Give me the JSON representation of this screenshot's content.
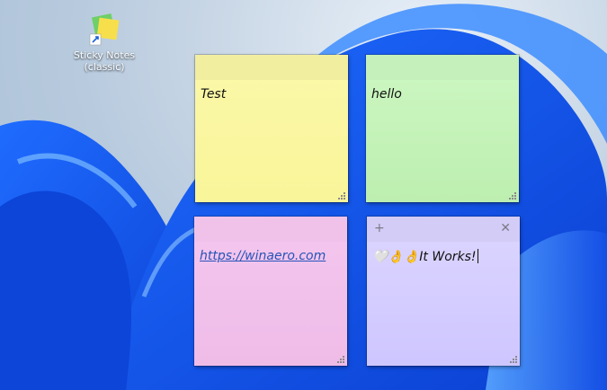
{
  "desktop": {
    "icon_label_line1": "Sticky Notes",
    "icon_label_line2": "(classic)"
  },
  "notes": [
    {
      "color": "#fbf8a9",
      "text": "Test"
    },
    {
      "color": "#cdf7c2",
      "text": "hello"
    },
    {
      "color": "#f4c6ee",
      "text": "https://winaero.com"
    },
    {
      "color": "#dcd6ff",
      "text": "It Works!",
      "emoji": "🤍👌👌",
      "add_icon": "+",
      "close_icon": "✕"
    }
  ]
}
